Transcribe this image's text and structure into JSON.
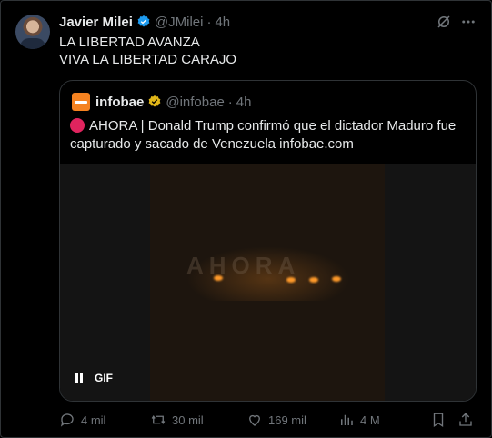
{
  "author": {
    "name": "Javier Milei",
    "handle": "@JMilei",
    "time": "4h"
  },
  "tweet": {
    "lines": [
      "LA LIBERTAD AVANZA",
      "VIVA LA LIBERTAD CARAJO"
    ]
  },
  "quote": {
    "name": "infobae",
    "handle": "@infobae",
    "time": "4h",
    "text": "AHORA | Donald Trump confirmó que el dictador Maduro fue capturado y sacado de Venezuela infobae.com",
    "media": {
      "overlay_text": "AHORA",
      "gif_label": "GIF"
    }
  },
  "actions": {
    "replies": "4 mil",
    "reposts": "30 mil",
    "likes": "169 mil",
    "views": "4 M"
  },
  "colors": {
    "verified_blue": "#1d9bf0",
    "verified_gold": "#e2b719",
    "infobae_orange": "#f58220",
    "muted": "#71767b"
  },
  "icons": [
    "grok-icon",
    "more-icon",
    "verified-badge-icon",
    "reply-icon",
    "repost-icon",
    "like-icon",
    "views-icon",
    "bookmark-icon",
    "share-icon",
    "pause-icon"
  ]
}
